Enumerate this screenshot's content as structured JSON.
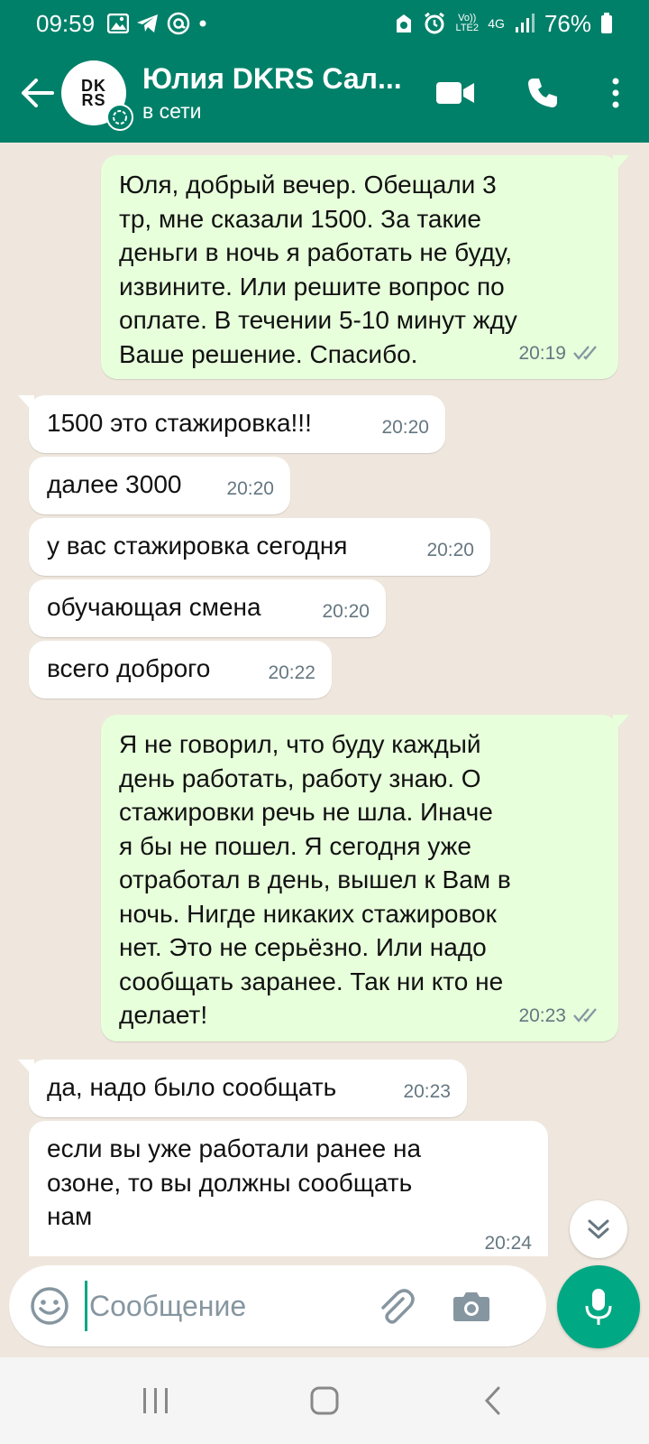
{
  "status": {
    "time": "09:59",
    "volte": "Vo)) LTE2",
    "network": "4G",
    "battery": "76%"
  },
  "header": {
    "avatar_text": "DK RS",
    "contact_name": "Юлия DKRS Сал...",
    "presence": "в сети",
    "back_icon": "arrow-left-icon",
    "video_icon": "video-camera-icon",
    "call_icon": "phone-icon",
    "menu_icon": "more-vertical-icon"
  },
  "messages": [
    {
      "dir": "out",
      "text": "Юля, добрый вечер. Обещали 3\nтр, мне сказали 1500. За такие\nденьги в ночь я работать не буду,\nизвините. Или решите вопрос по\nоплате. В течении 5-10 минут жду\nВаше решение. Спасибо.",
      "time": "20:19",
      "read": true
    },
    {
      "dir": "in",
      "text": "1500 это стажировка!!!",
      "time": "20:20"
    },
    {
      "dir": "in",
      "text": "далее 3000",
      "time": "20:20"
    },
    {
      "dir": "in",
      "text": "у вас стажировка сегодня",
      "time": "20:20"
    },
    {
      "dir": "in",
      "text": "обучающая смена",
      "time": "20:20"
    },
    {
      "dir": "in",
      "text": "всего доброго",
      "time": "20:22"
    },
    {
      "dir": "out",
      "text": "Я не говорил, что буду каждый\nдень работать, работу знаю. О\nстажировки речь не шла. Иначе\nя бы не пошел. Я сегодня уже\nотработал в день, вышел к Вам в\nночь. Нигде никаких стажировок\nнет. Это не серьёзно. Или надо\nсообщать заранее. Так ни кто не\nделает!",
      "time": "20:23",
      "read": true
    },
    {
      "dir": "in",
      "text": "да, надо было сообщать",
      "time": "20:23"
    },
    {
      "dir": "in",
      "text": "если вы уже работали ранее на\nозоне, то вы должны сообщать\nнам",
      "time": "20:24"
    }
  ],
  "composer": {
    "placeholder": "Сообщение",
    "emoji_icon": "emoji-icon",
    "attach_icon": "paperclip-icon",
    "camera_icon": "camera-icon",
    "mic_icon": "microphone-icon"
  },
  "colors": {
    "header": "#008069",
    "outgoing_bubble": "#e7ffdb",
    "incoming_bubble": "#ffffff",
    "chat_background": "#efe7dd",
    "accent": "#00a884",
    "read_ticks": "#8696a0"
  }
}
